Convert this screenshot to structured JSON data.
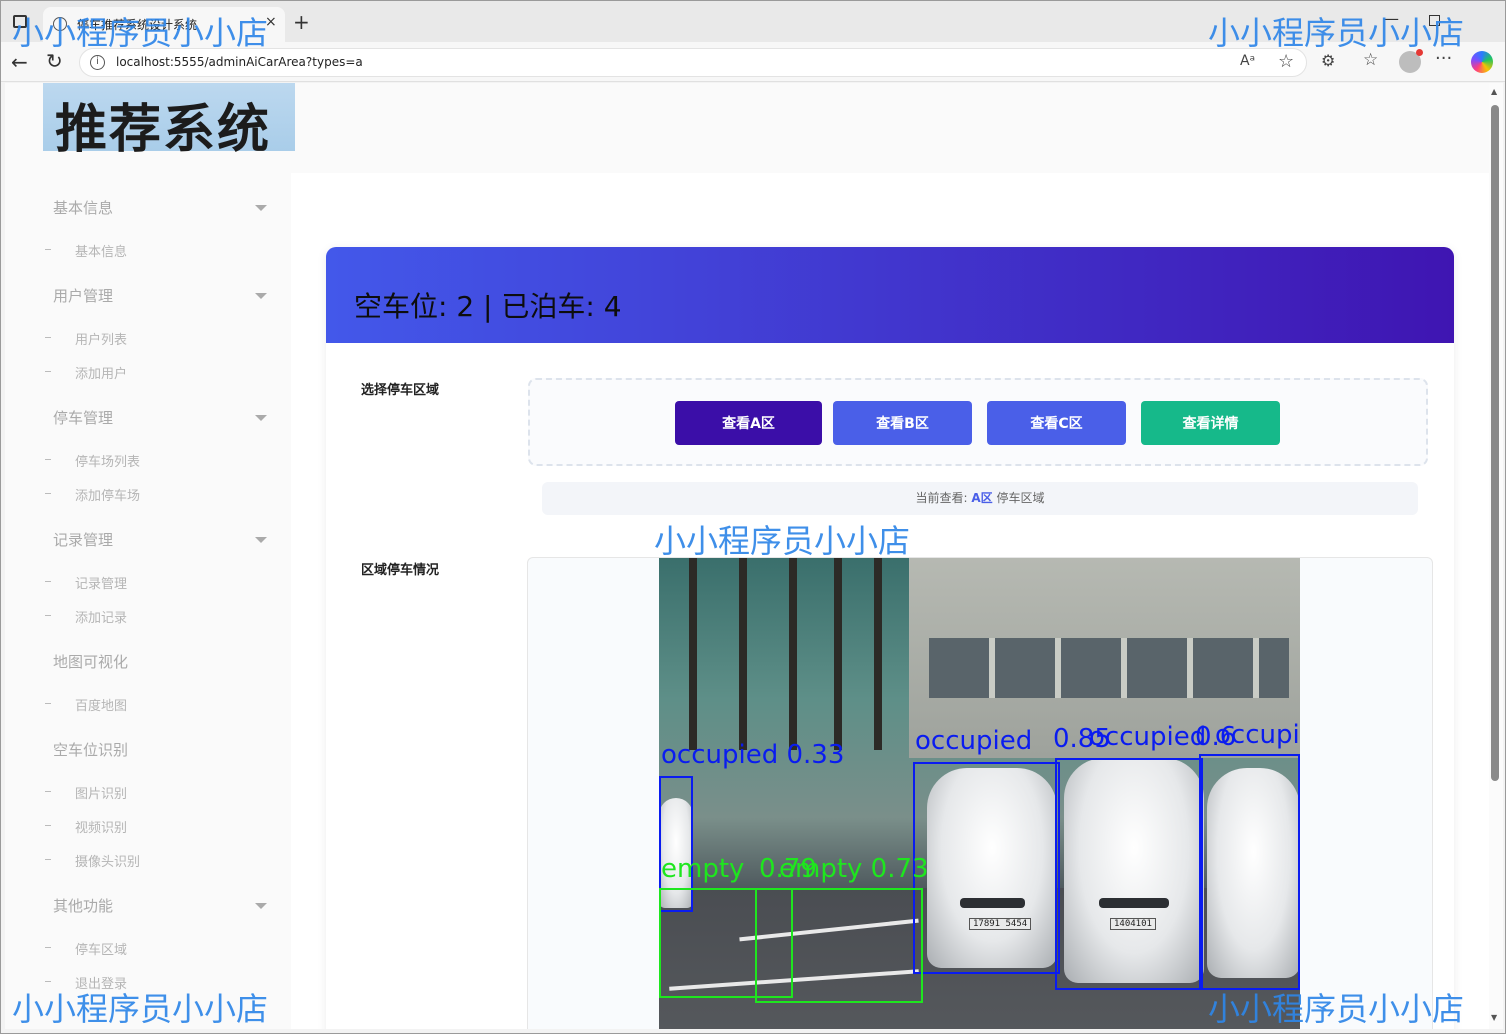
{
  "browser": {
    "tab_title": "停车推荐系统设计系统",
    "url": "localhost:5555/adminAiCarArea?types=a"
  },
  "logo_text": "推荐系统",
  "sidebar": {
    "groups": [
      {
        "label": "基本信息",
        "items": [
          "基本信息"
        ]
      },
      {
        "label": "用户管理",
        "items": [
          "用户列表",
          "添加用户"
        ]
      },
      {
        "label": "停车管理",
        "items": [
          "停车场列表",
          "添加停车场"
        ]
      },
      {
        "label": "记录管理",
        "items": [
          "记录管理",
          "添加记录"
        ]
      },
      {
        "label": "地图可视化",
        "items": [
          "百度地图"
        ]
      },
      {
        "label": "空车位识别",
        "items": [
          "图片识别",
          "视频识别",
          "摄像头识别"
        ]
      },
      {
        "label": "其他功能",
        "items": [
          "停车区域",
          "退出登录"
        ]
      }
    ]
  },
  "main": {
    "header_title": "空车位: 2 | 已泊车: 4",
    "select_label": "选择停车区域",
    "buttons": [
      {
        "label": "查看A区",
        "color": "#3b0ea8"
      },
      {
        "label": "查看B区",
        "color": "#4a5fe8"
      },
      {
        "label": "查看C区",
        "color": "#4a5fe8"
      },
      {
        "label": "查看详情",
        "color": "#16b98a"
      }
    ],
    "current_prefix": "当前查看:",
    "current_area": "A区",
    "current_suffix": "停车区域",
    "status_label": "区域停车情况"
  },
  "detections": {
    "labels": [
      {
        "text": "occupied 0.33",
        "color": "blue"
      },
      {
        "text": "occupied",
        "color": "blue"
      },
      {
        "text": "0.85",
        "color": "blue"
      },
      {
        "text": "occupied",
        "color": "blue"
      },
      {
        "text": "0.6",
        "color": "blue"
      },
      {
        "text": "occupie",
        "color": "blue"
      },
      {
        "text": "empty",
        "color": "green"
      },
      {
        "text": "0.79",
        "color": "green"
      },
      {
        "text": "empty 0.73",
        "color": "green"
      }
    ],
    "plates": [
      "17891 5454",
      "1404101"
    ]
  },
  "watermark": "小小程序员小小店"
}
